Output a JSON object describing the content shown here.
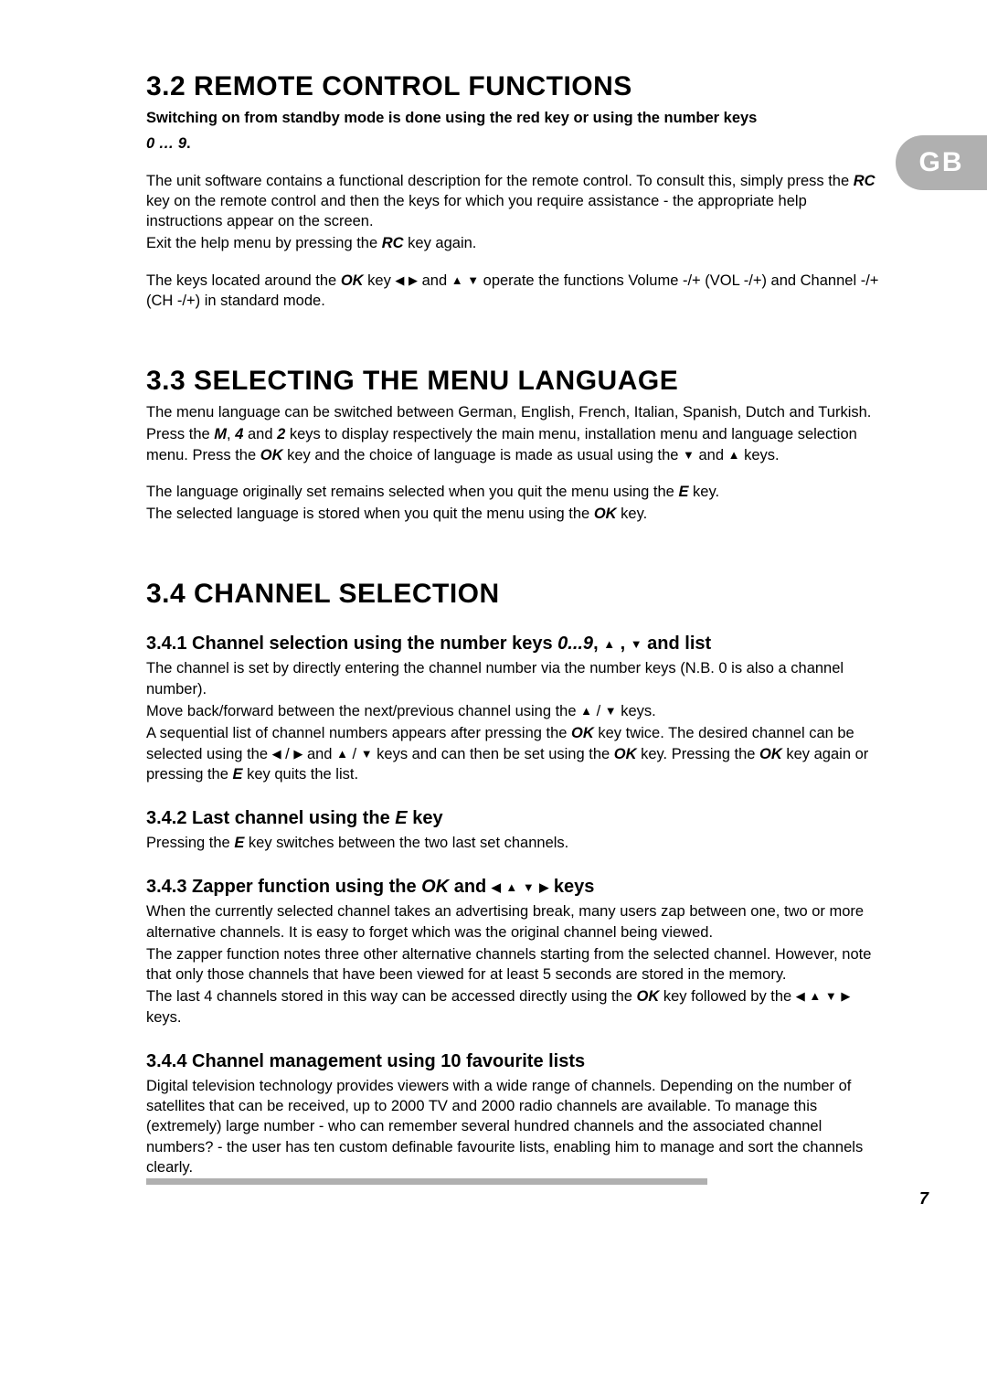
{
  "sideTab": "GB",
  "pageNumber": "7",
  "sec32": {
    "heading": "3.2  REMOTE CONTROL FUNCTIONS",
    "intro1": "Switching on from standby mode is done using the red key or using the number keys",
    "intro2": "0 … 9",
    "intro2_suffix": ".",
    "p1a": "The unit software contains a functional description for the remote control. To consult this, simply press the ",
    "p1_rc": "RC",
    "p1b": "  key on the remote control and then the keys for which you require assistance - the appropriate help instructions appear on the screen.",
    "p2a": "Exit the help menu by pressing the  ",
    "p2_rc": "RC",
    "p2b": "  key again.",
    "p3a": "The keys located around the ",
    "p3_ok": "OK",
    "p3b": " key  ",
    "p3c": "   and   ",
    "p3d": "    operate the functions Volume -/+ (VOL -/+) and Channel -/+ (CH -/+) in standard mode."
  },
  "sec33": {
    "heading": "3.3  SELECTING THE MENU LANGUAGE",
    "p1": "The menu language can be switched between German, English, French, Italian, Spanish, Dutch and Turkish.",
    "p2a": "Press the ",
    "m": "M",
    "comma": ", ",
    "four": "4",
    "and": " and ",
    "two": "2",
    "p2b": " keys to display respectively the main menu, installation menu and language selection menu. Press the ",
    "ok": "OK",
    "p2c": "  key and the choice of language is made as usual using the  ",
    "p2d": "  and  ",
    "p2e": "  keys.",
    "p3a": "The language originally set remains selected when you quit the menu using the ",
    "e": "E",
    "p3b": " key.",
    "p4a": "The selected language is stored when you quit the menu using the ",
    "p4b": " key."
  },
  "sec34": {
    "heading": "3.4  CHANNEL SELECTION",
    "s341": {
      "h_a": "3.4.1  Channel selection using the number keys ",
      "h_keys": "0...9",
      "h_b": ",  ",
      "h_c": " ,  ",
      "h_d": "  and list",
      "p1": "The channel is set by directly entering the channel number via the number keys (N.B. 0 is also a channel number).",
      "p2a": "Move back/forward between the next/previous channel using the   ",
      "p2b": "  /  ",
      "p2c": "    keys.",
      "p3a": "A sequential list of channel numbers appears after pressing the  ",
      "ok": "OK",
      "p3b": "  key twice. The desired channel can be selected using the   ",
      "p3c": "  /  ",
      "p3d": "   and   ",
      "p3e": "  /  ",
      "p3f": "    keys and can then be set using the  ",
      "p3g": "  key. Pressing the  ",
      "p3h": "  key again or pressing the  ",
      "e": "E",
      "p3i": "  key quits the list."
    },
    "s342": {
      "h_a": "3.4.2  Last channel using the  ",
      "h_e": "E",
      "h_b": "  key",
      "p_a": "Pressing the  ",
      "p_e": "E",
      "p_b": "  key switches between the two last set channels."
    },
    "s343": {
      "h_a": "3.4.3  Zapper function using the  ",
      "h_ok": "OK",
      "h_b": "  and   ",
      "h_c": "    keys",
      "p1": "When the currently selected channel takes an advertising break, many users zap between one, two or more alternative channels. It is easy to forget which was the original channel being viewed.",
      "p2": "The zapper function notes three other alternative channels starting from the selected channel. However, note that only those channels that have been viewed for at least 5 seconds are stored in the memory.",
      "p3a": "The last 4 channels stored in this way can be accessed directly using the  ",
      "ok": "OK",
      "p3b": "  key followed by the   ",
      "p3c": "    keys."
    },
    "s344": {
      "h": "3.4.4  Channel management using 10 favourite lists",
      "p1": "Digital television technology provides viewers with a wide range of channels. Depending on the number of satellites that can be received, up to 2000 TV and 2000 radio channels are available. To manage this (extremely) large number - who can remember several hundred channels and the associated channel numbers? - the user has ten custom definable favourite lists, enabling him to manage and sort the channels clearly."
    }
  }
}
